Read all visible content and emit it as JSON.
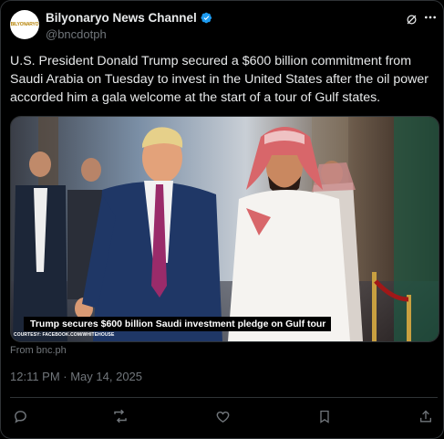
{
  "account": {
    "logo_text": "BILYONARYO",
    "name": "Bilyonaryo News Channel",
    "handle": "@bncdotph"
  },
  "post": {
    "text": "U.S. President Donald Trump secured a $600 billion commitment from Saudi Arabia on Tuesday to invest in the United States after the oil power accorded him a gala welcome at the start of a tour of Gulf states.",
    "media": {
      "caption": "Trump secures $600 billion Saudi investment pledge on Gulf tour",
      "courtesy": "COURTESY: FACEBOOK.COM/WHITEHOUSE"
    },
    "source": "From bnc.ph",
    "timestamp": "12:11 PM · May 14, 2025"
  },
  "icons": {
    "verified": "verified-badge-icon",
    "grok": "grok-icon",
    "more": "more-icon",
    "reply": "reply-icon",
    "repost": "repost-icon",
    "like": "like-icon",
    "bookmark": "bookmark-icon",
    "share": "share-icon"
  },
  "colors": {
    "background": "#000000",
    "text": "#e7e9ea",
    "muted": "#71767b",
    "verified": "#1d9bf0",
    "border": "#2f3336"
  }
}
